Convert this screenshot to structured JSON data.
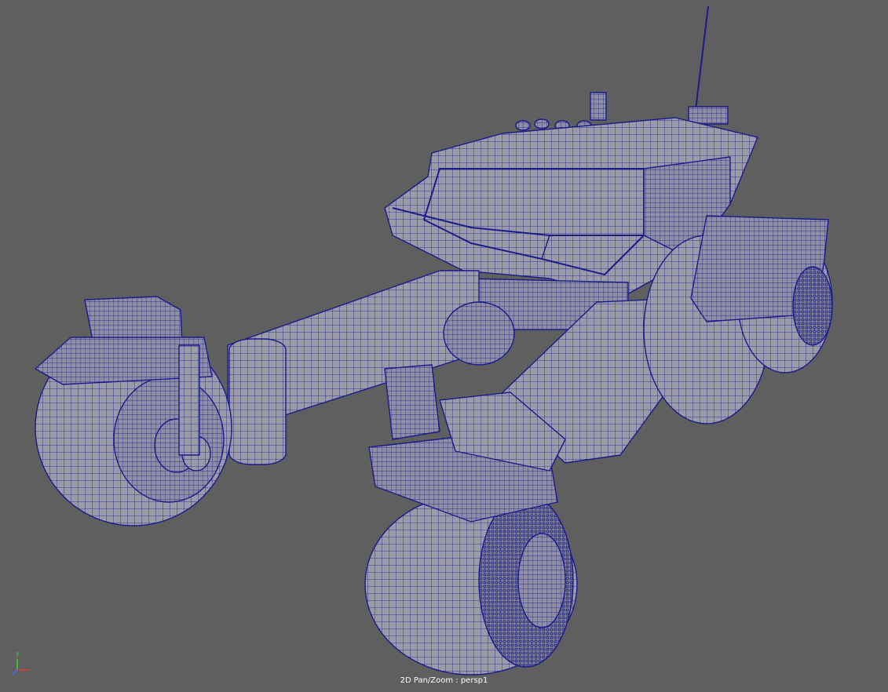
{
  "viewport": {
    "camera": "persp1",
    "status_text": "2D Pan/Zoom : persp1",
    "background_color": "#5f5f5f",
    "wire_color": "#1b1b8a",
    "fill_color": "#9a9aa8"
  },
  "axis_gizmo": {
    "y_label": "y",
    "x_color": "#e03a3a",
    "y_color": "#3ad23a",
    "z_color": "#4a6aff"
  }
}
